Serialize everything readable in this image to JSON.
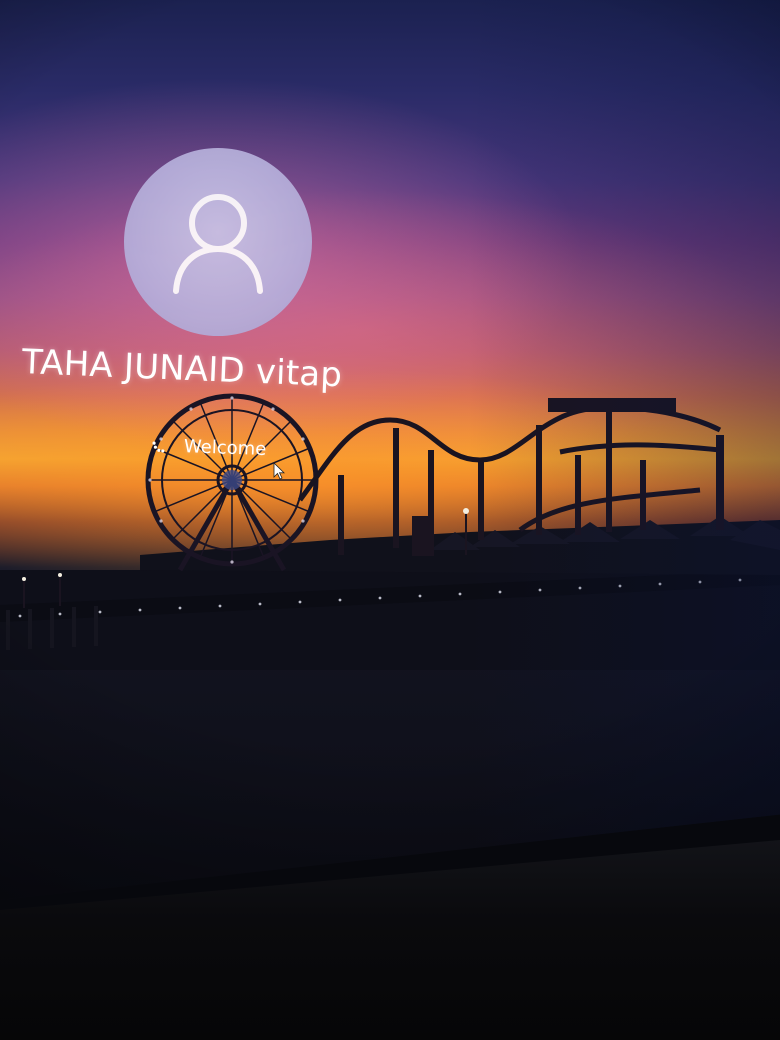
{
  "lock_screen": {
    "user_name": "TAHA JUNAID vitap",
    "status_text": "Welcome"
  },
  "icons": {
    "avatar": "user-silhouette-icon",
    "spinner": "loading-spinner-icon",
    "cursor": "mouse-pointer-icon"
  },
  "colors": {
    "text": "#ffffff",
    "avatar_fill": "#b7b1dc",
    "sunset_orange": "#f2a733",
    "sky_dark": "#1b2150"
  }
}
